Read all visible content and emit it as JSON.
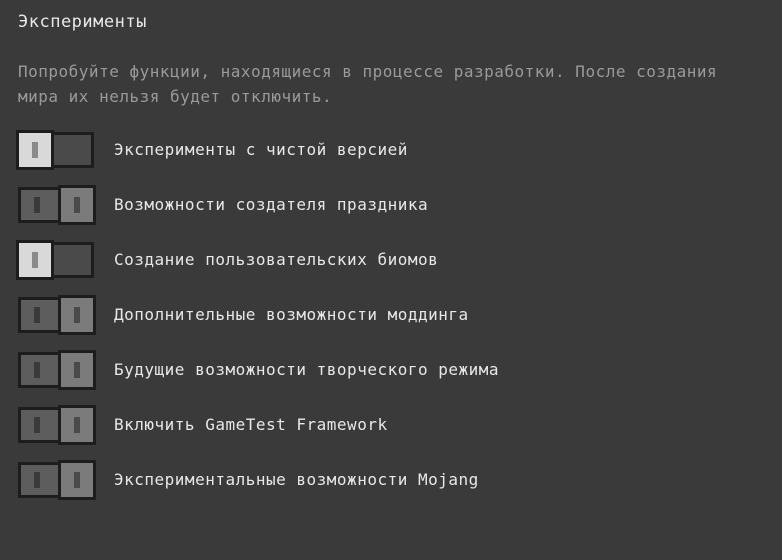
{
  "section": {
    "title": "Эксперименты",
    "description": "Попробуйте функции, находящиеся в процессе разработки. После создания мира их нельзя будет отключить."
  },
  "toggles": [
    {
      "label": "Эксперименты с чистой версией",
      "state": "on"
    },
    {
      "label": "Возможности создателя праздника",
      "state": "off"
    },
    {
      "label": "Создание пользовательских биомов",
      "state": "on"
    },
    {
      "label": "Дополнительные возможности моддинга",
      "state": "off"
    },
    {
      "label": "Будущие возможности творческого режима",
      "state": "off"
    },
    {
      "label": "Включить GameTest Framework",
      "state": "off"
    },
    {
      "label": "Экспериментальные возможности Mojang",
      "state": "off"
    }
  ]
}
